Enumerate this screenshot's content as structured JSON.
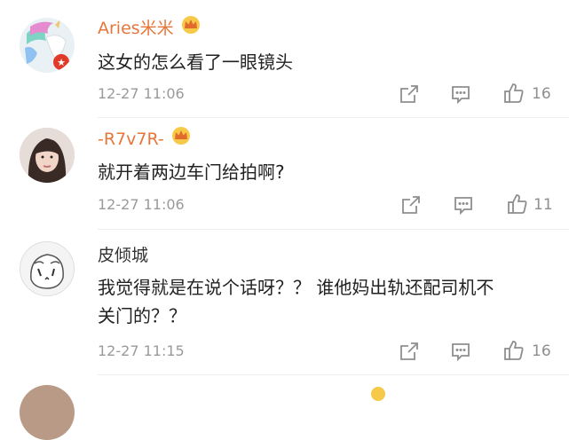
{
  "comments": [
    {
      "username": "Aries米米",
      "text": "这女的怎么看了一眼镜头",
      "time": "12-27 11:06",
      "likes": "16"
    },
    {
      "username": "-R7v7R-",
      "text": "就开着两边车门给拍啊?",
      "time": "12-27 11:06",
      "likes": "11"
    },
    {
      "username": "皮倾城",
      "text_line1": "我觉得就是在说个话呀？？ 谁他妈出轨还配司机不",
      "text_line2": "关门的？？",
      "time": "12-27 11:15",
      "likes": "16"
    }
  ],
  "colors": {
    "vip_name": "#e8763a",
    "icon_gray": "#8e8e8e",
    "crown_gold": "#f0b43a"
  }
}
